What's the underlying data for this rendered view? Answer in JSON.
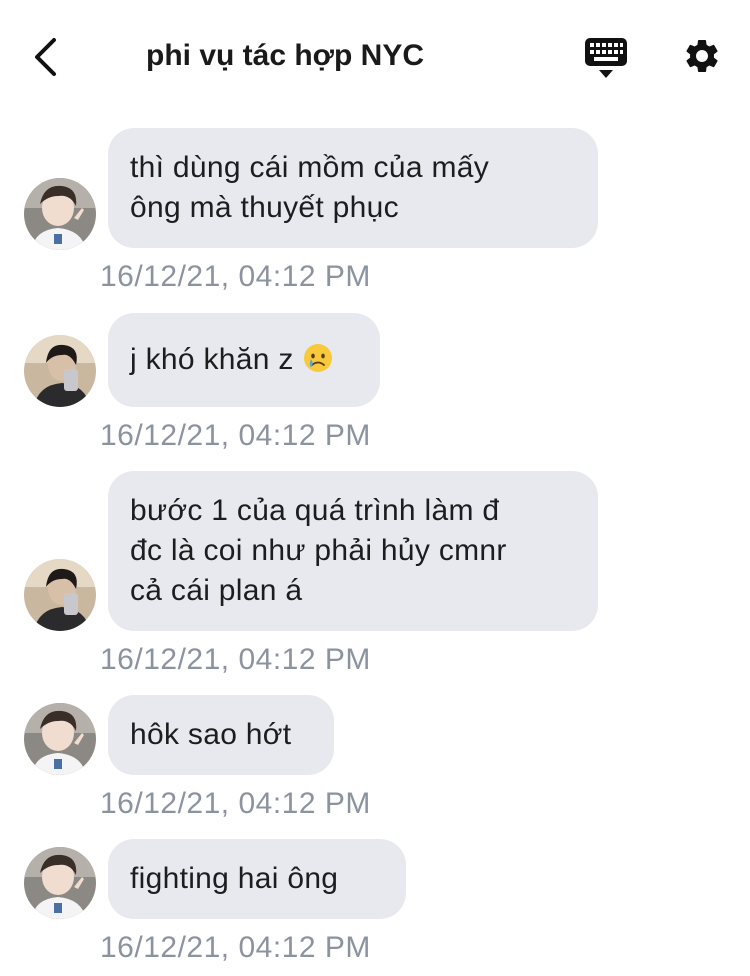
{
  "header": {
    "title": "phi vụ tác hợp NYC",
    "back_icon": "chevron-left-icon",
    "keyboard_icon": "keyboard-icon",
    "settings_icon": "gear-icon"
  },
  "messages": [
    {
      "lines": [
        "thì dùng cái mồm của mấy",
        "ông mà thuyết phục"
      ],
      "time": "16/12/21, 04:12 PM",
      "avatar": "avatar-user-a"
    },
    {
      "lines": [
        "j khó khăn z"
      ],
      "emoji": "crying-face-emoji",
      "time": "16/12/21, 04:12 PM",
      "avatar": "avatar-user-b"
    },
    {
      "lines": [
        "bước 1 của quá trình làm đ",
        "đc là coi như phải hủy cmnr",
        "cả cái plan á"
      ],
      "time": "16/12/21, 04:12 PM",
      "avatar": "avatar-user-b"
    },
    {
      "lines": [
        "hôk sao hớt"
      ],
      "time": "16/12/21, 04:12 PM",
      "avatar": "avatar-user-a"
    },
    {
      "lines": [
        "fighting hai ông"
      ],
      "time": "16/12/21, 04:12 PM",
      "avatar": "avatar-user-a"
    }
  ],
  "colors": {
    "bubble": "#e8e9ee",
    "timestamp": "#8c93a0",
    "title": "#1a1a1a"
  }
}
